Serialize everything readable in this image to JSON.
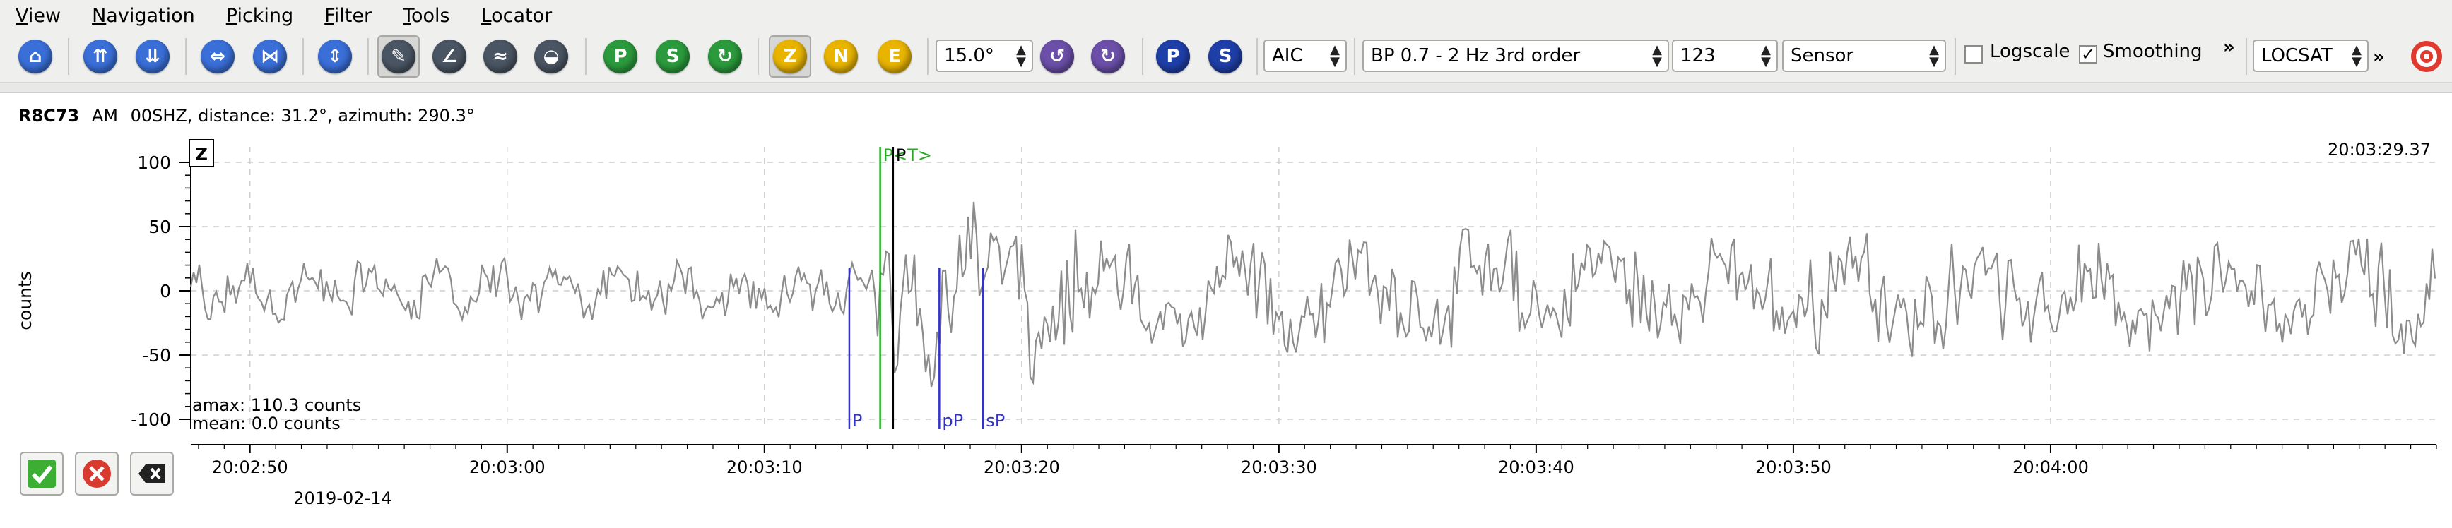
{
  "menu": [
    "View",
    "Navigation",
    "Picking",
    "Filter",
    "Tools",
    "Locator"
  ],
  "toolbar": {
    "zoom_value": "15.0°",
    "picker_method": "AIC",
    "filter": "BP 0.7 - 2 Hz  3rd order",
    "filter_code": "123",
    "unit_mode": "Sensor",
    "logscale_label": "Logscale",
    "logscale_checked": false,
    "smoothing_label": "Smoothing",
    "smoothing_checked": true,
    "overflow": "»",
    "locator": "LOCSAT",
    "overflow2": "»",
    "component_z": "Z",
    "component_n": "N",
    "component_e": "E",
    "phase_p": "P",
    "phase_s": "S"
  },
  "trace": {
    "station": "R8C73",
    "network": "AM",
    "channel": "00SHZ",
    "info": ", distance: 31.2°, azimuth: 290.3°",
    "component_box": "Z",
    "time_readout": "20:03:29.37",
    "amax": "amax: 110.3 counts",
    "mean": "mean: 0.0 counts",
    "ylabel": "counts",
    "date": "2019-02-14"
  },
  "chart_data": {
    "type": "line",
    "ylabel": "counts",
    "ylim": [
      -100,
      100
    ],
    "yticks": [
      "100",
      "50",
      "0",
      "-50",
      "-100"
    ],
    "xticks": [
      "20:02:50",
      "20:03:00",
      "20:03:10",
      "20:03:20",
      "20:03:30",
      "20:03:40",
      "20:03:50",
      "20:04:00"
    ],
    "x_range_seconds": [
      -27.3,
      60.0
    ],
    "grid": true,
    "series": [
      {
        "color": "#8c8c8c"
      }
    ],
    "picks": [
      {
        "label": "P<T>",
        "time_s": -0.5,
        "color": "#22aa22"
      },
      {
        "label": "P",
        "time_s": 0.0,
        "color": "#000000"
      },
      {
        "label": "P",
        "time_s": -1.7,
        "color": "#3333cc"
      },
      {
        "label": "pP",
        "time_s": 1.8,
        "color": "#3333cc"
      },
      {
        "label": "sP",
        "time_s": 3.5,
        "color": "#3333cc"
      }
    ]
  }
}
